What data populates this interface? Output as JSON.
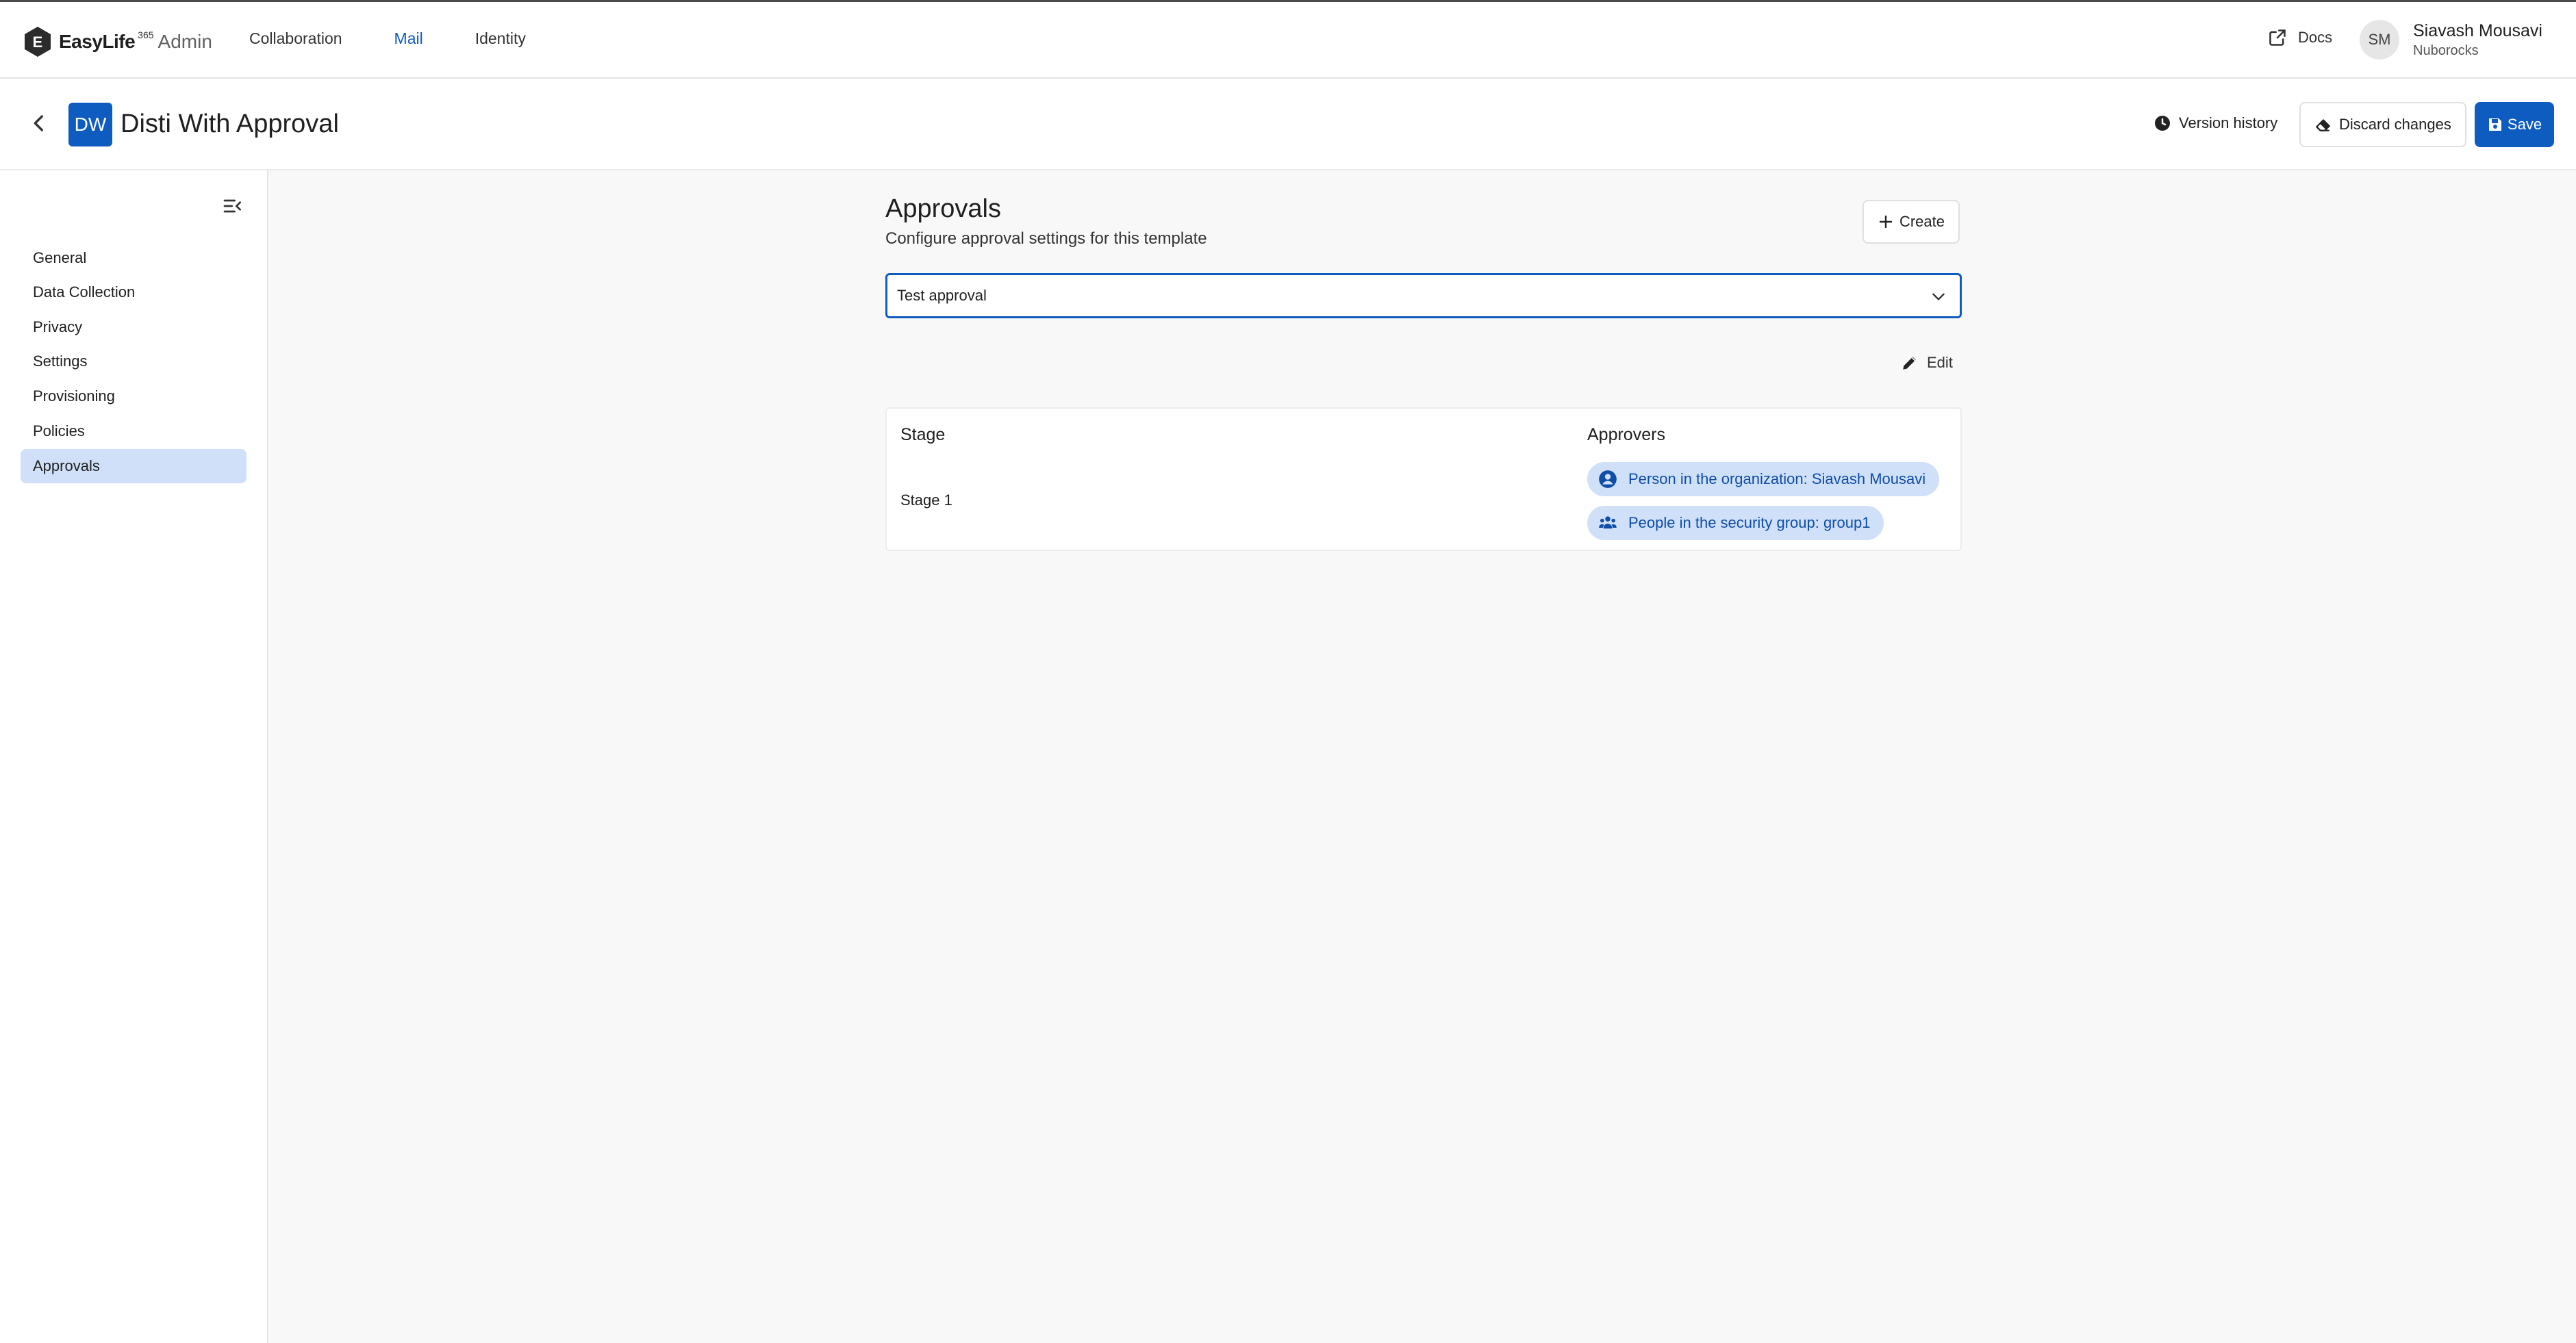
{
  "app": {
    "brand": "EasyLife",
    "brand_sup": "365",
    "brand_suffix": "Admin"
  },
  "nav": {
    "items": [
      {
        "label": "Collaboration",
        "active": false
      },
      {
        "label": "Mail",
        "active": true
      },
      {
        "label": "Identity",
        "active": false
      }
    ]
  },
  "topbar": {
    "docs_label": "Docs",
    "user": {
      "initials": "SM",
      "name": "Siavash Mousavi",
      "org": "Nuborocks"
    }
  },
  "header": {
    "badge": "DW",
    "title": "Disti With Approval",
    "version_history_label": "Version history",
    "discard_label": "Discard changes",
    "save_label": "Save"
  },
  "sidebar": {
    "items": [
      {
        "label": "General",
        "active": false
      },
      {
        "label": "Data Collection",
        "active": false
      },
      {
        "label": "Privacy",
        "active": false
      },
      {
        "label": "Settings",
        "active": false
      },
      {
        "label": "Provisioning",
        "active": false
      },
      {
        "label": "Policies",
        "active": false
      },
      {
        "label": "Approvals",
        "active": true
      }
    ]
  },
  "main": {
    "title": "Approvals",
    "description": "Configure approval settings for this template",
    "create_label": "Create",
    "selected_approval": "Test approval",
    "edit_label": "Edit",
    "table": {
      "columns": [
        "Stage",
        "Approvers"
      ],
      "rows": [
        {
          "stage": "Stage 1",
          "approvers": [
            {
              "icon": "person-circle-icon",
              "label": "Person in the organization: Siavash Mousavi"
            },
            {
              "icon": "people-group-icon",
              "label": "People in the security group: group1"
            }
          ]
        }
      ]
    }
  },
  "colors": {
    "accent": "#0f5cc0",
    "chip_bg": "#cfe0f8",
    "chip_text": "#0f4da8",
    "active_side_bg": "#cfe0f8",
    "main_bg": "#f8f8f8"
  }
}
